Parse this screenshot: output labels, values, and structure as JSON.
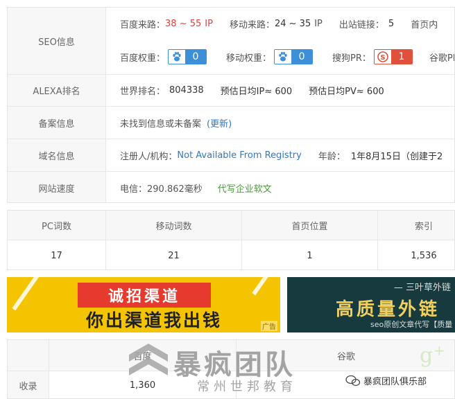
{
  "seo": {
    "label": "SEO信息",
    "baidu_traffic_label": "百度来路：",
    "baidu_traffic_value": "38 ~ 55",
    "baidu_traffic_unit": "IP",
    "mobile_traffic_label": "移动来路：",
    "mobile_traffic_value": "24 ~ 35",
    "mobile_traffic_unit": "IP",
    "outlinks_label": "出站链接：",
    "outlinks_value": "5",
    "homepage_label": "首页内",
    "baidu_weight_label": "百度权重：",
    "baidu_weight_value": "0",
    "mobile_weight_label": "移动权重：",
    "mobile_weight_value": "0",
    "sogou_pr_label": "搜狗PR：",
    "sogou_pr_value": "1",
    "google_pr_label": "谷歌PR"
  },
  "alexa": {
    "label": "ALEXA排名",
    "world_label": "世界排名：",
    "world_value": "804338",
    "est_ip": "预估日均IP≈ 600",
    "est_pv": "预估日均PV≈ 600"
  },
  "icp": {
    "label": "备案信息",
    "text": "未找到信息或未备案",
    "update": "(更新)"
  },
  "domain": {
    "label": "域名信息",
    "registrant_label": "注册人/机构：",
    "registrant_value": "Not Available From Registry",
    "age_label": "年龄：",
    "age_value": "1年8月15日（创建于2"
  },
  "speed": {
    "label": "网站速度",
    "telecom": "电信：290.862毫秒",
    "link": "代写企业软文"
  },
  "stats": {
    "headers": [
      "PC词数",
      "移动词数",
      "首页位置",
      "索引"
    ],
    "values": [
      "17",
      "21",
      "1",
      "1,536"
    ]
  },
  "ads": {
    "left_box": "诚招渠道",
    "left_sub": "你出渠道我出钱",
    "left_tag": "广告",
    "right_top": "— 三叶草外链",
    "right_main": "高质量外链",
    "right_sub": "seo原创文章代写【质量"
  },
  "index_table": {
    "col_baidu": "百度",
    "col_google": "谷歌",
    "row_label": "收录",
    "baidu_value": "1,360"
  },
  "watermark": {
    "main": "暴疯团队",
    "sub": "常州世邦教育",
    "wechat": "暴疯团队俱乐部"
  },
  "colors": {
    "badge_blue": "#3d8fd8",
    "badge_red": "#e0503a",
    "accent_red": "#e0403c",
    "link_blue": "#2f78c4",
    "link_green": "#4c9a3c"
  }
}
